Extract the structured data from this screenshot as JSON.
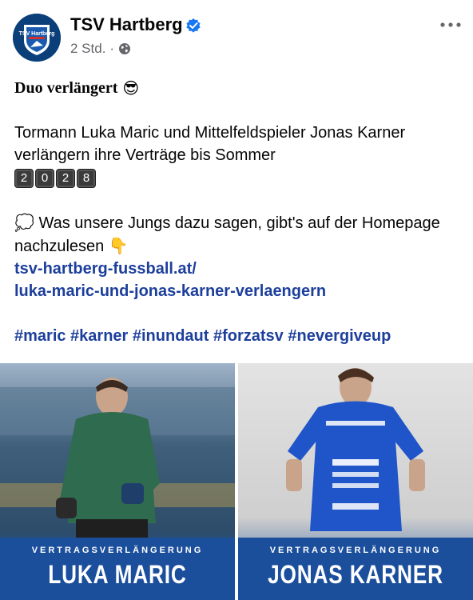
{
  "page": {
    "name": "TSV Hartberg",
    "timestamp": "2 Std.",
    "separator": "·",
    "audience_icon": "globe-icon",
    "verified_icon": "verified-badge-icon",
    "more_icon": "more-options-icon"
  },
  "post": {
    "title": "Duo verlängert",
    "title_emoji": "😎",
    "paragraph1": "Tormann Luka Maric und Mittelfeldspieler Jonas Karner verlängern ihre Verträge bis Sommer",
    "year_digits": [
      "2",
      "0",
      "2",
      "8"
    ],
    "paragraph2_emoji": "💭",
    "paragraph2": "Was unsere Jungs dazu sagen, gibt's auf der Homepage nachzulesen",
    "paragraph2_end_emoji": "👇",
    "link_line1": "tsv-hartberg-fussball.at/",
    "link_line2": "luka-maric-und-jonas-karner-verlaengern",
    "hashtags": "#maric #karner #inundaut #forzatsv #nevergiveup"
  },
  "photos": [
    {
      "subtitle": "VERTRAGSVERLÄNGERUNG",
      "player": "LUKA MARIC"
    },
    {
      "subtitle": "VERTRAGSVERLÄNGERUNG",
      "player": "JONAS KARNER"
    }
  ],
  "colors": {
    "link": "#1d3f9c",
    "meta": "#65676b",
    "verified": "#1877f2",
    "banner": "#1b4f9c"
  }
}
